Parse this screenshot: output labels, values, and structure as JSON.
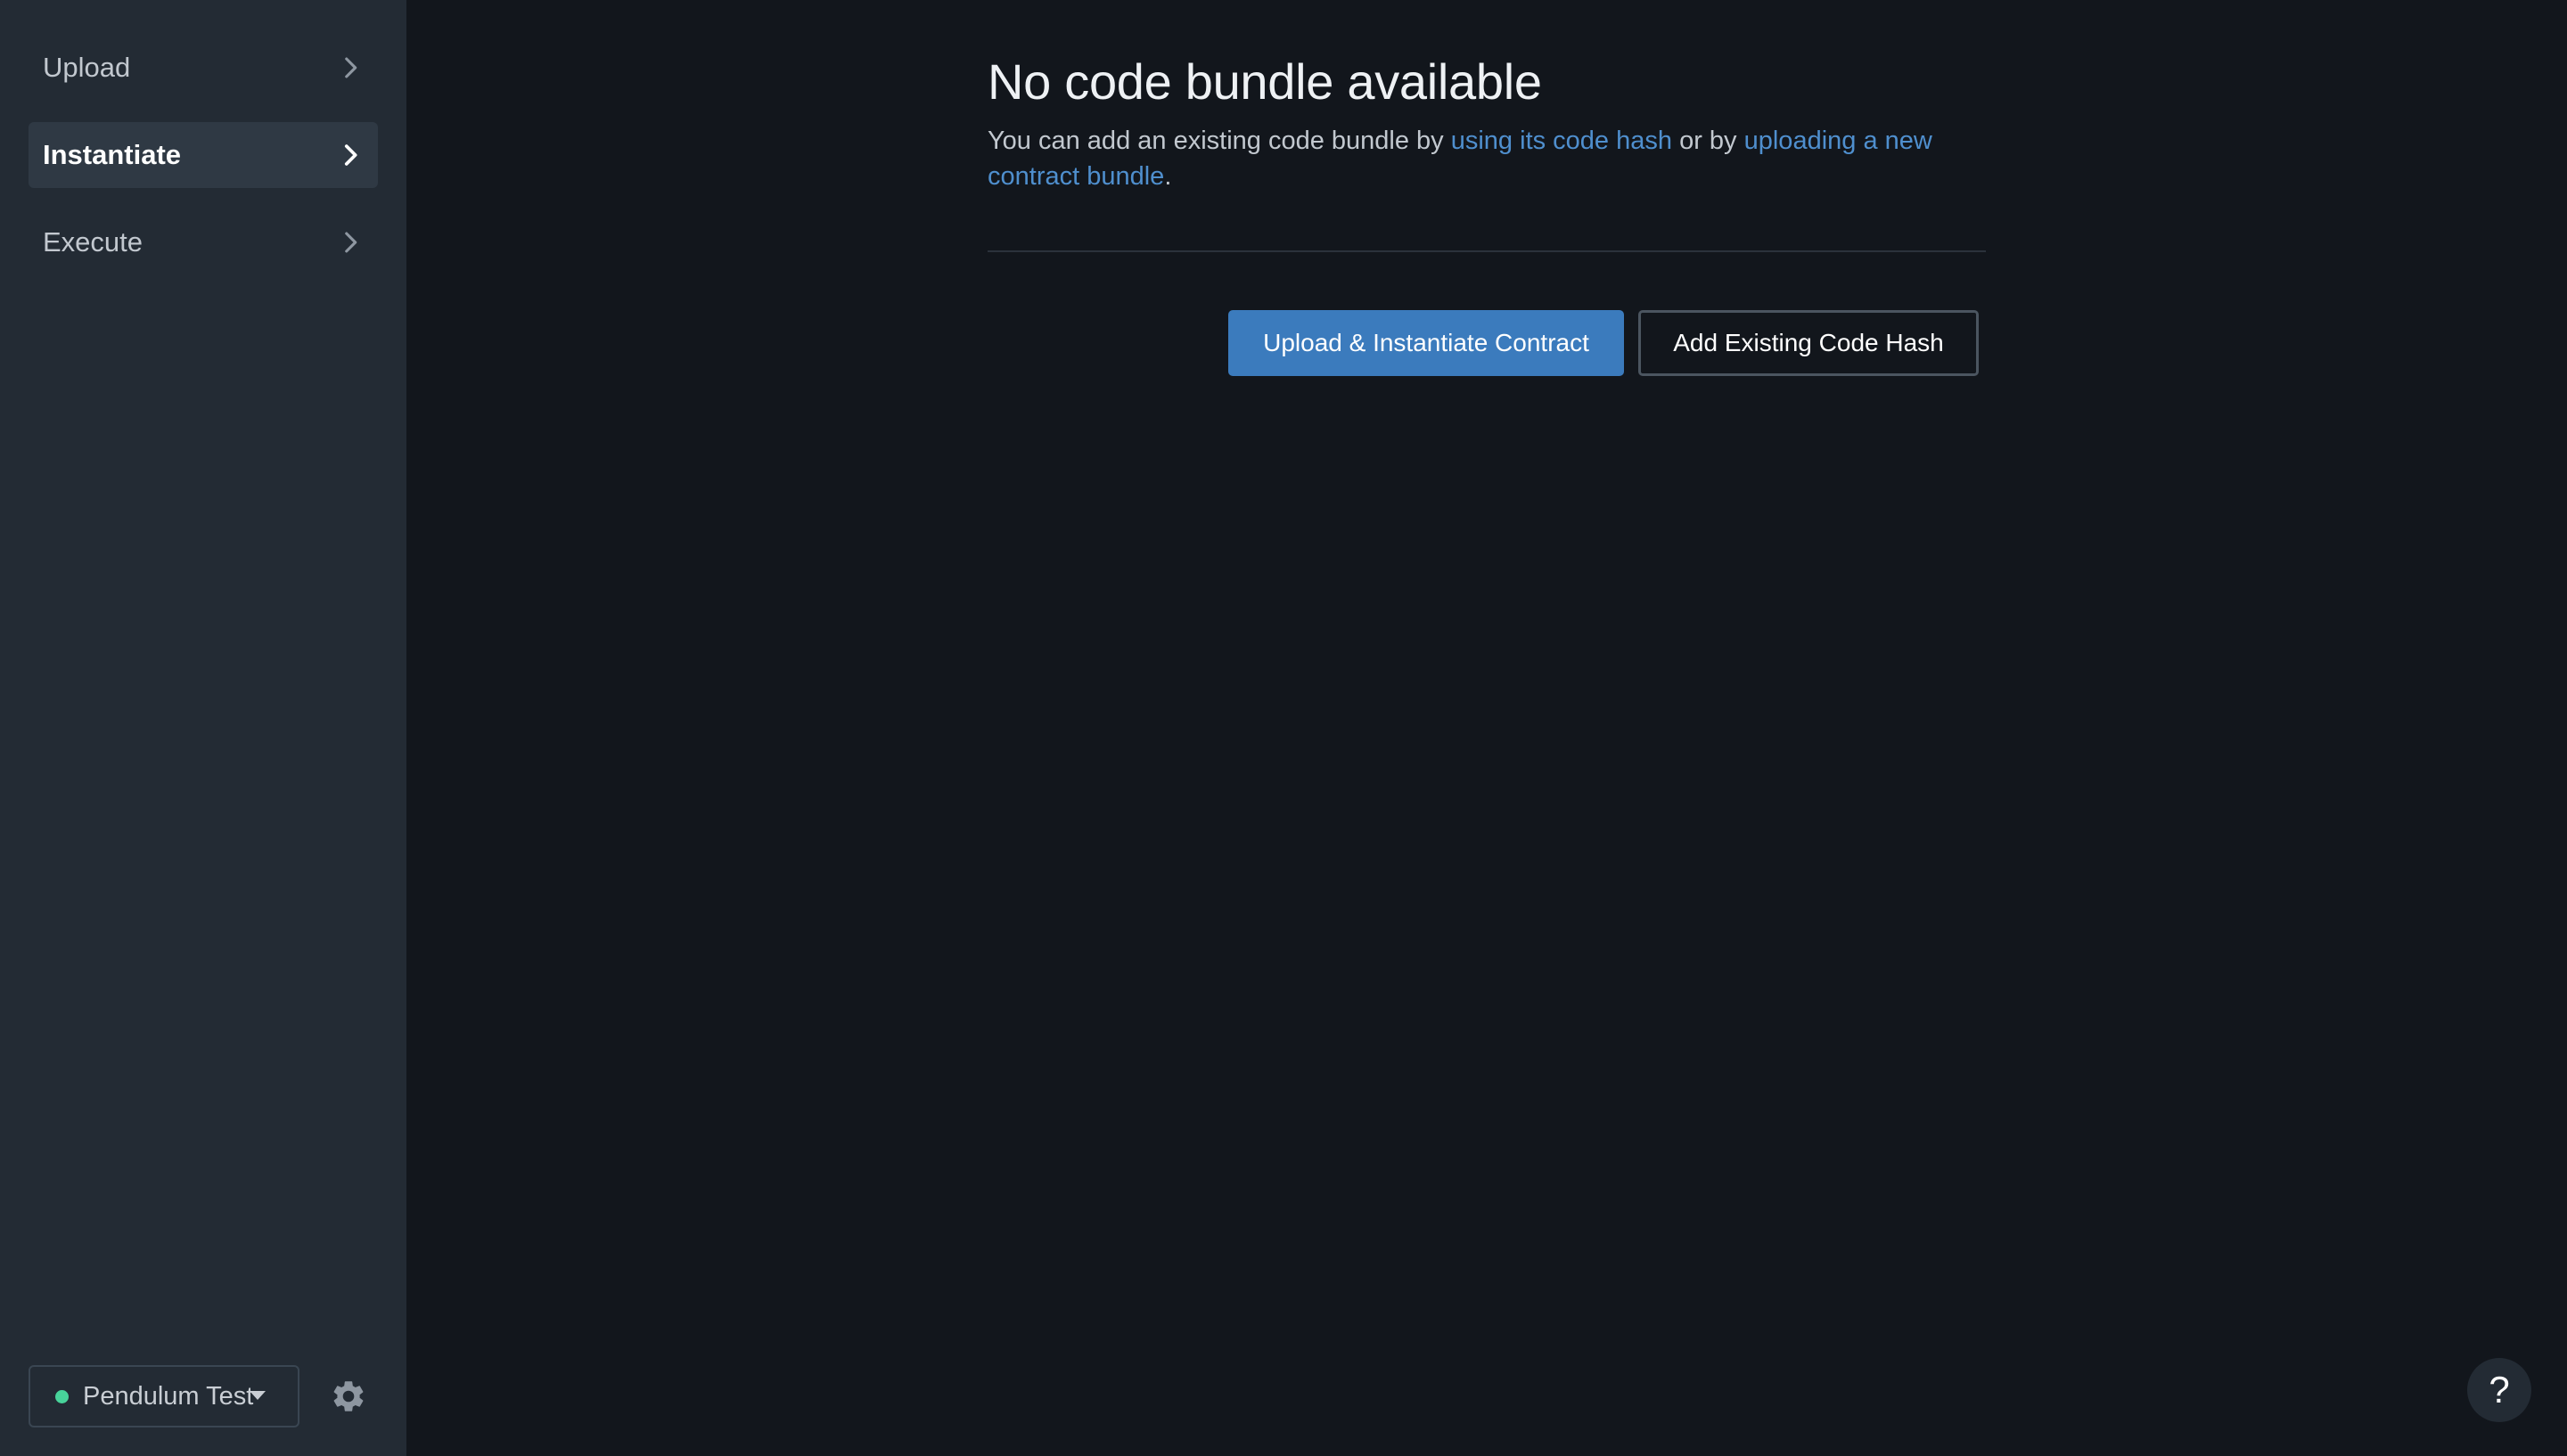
{
  "sidebar": {
    "items": [
      {
        "label": "Upload",
        "icon": "chevron-right-icon",
        "active": false
      },
      {
        "label": "Instantiate",
        "icon": "chevron-right-icon",
        "active": true
      },
      {
        "label": "Execute",
        "icon": "chevron-right-icon",
        "active": false
      }
    ],
    "network": {
      "label": "Pendulum Test",
      "status_color": "#48d39a",
      "icon": "chevron-down-icon"
    },
    "settings_icon": "gear-icon"
  },
  "main": {
    "title": "No code bundle available",
    "description": {
      "before": "You can add an existing code bundle by ",
      "link1": "using its code hash",
      "middle": " or by ",
      "link2": "uploading a new contract bundle",
      "after": "."
    },
    "buttons": {
      "primary": "Upload & Instantiate Contract",
      "secondary": "Add Existing Code Hash"
    }
  },
  "help": {
    "label": "?",
    "icon": "help-icon"
  },
  "colors": {
    "background": "#12161c",
    "sidebar": "#232b34",
    "accent": "#3b7bbd",
    "link": "#4f8fce"
  }
}
